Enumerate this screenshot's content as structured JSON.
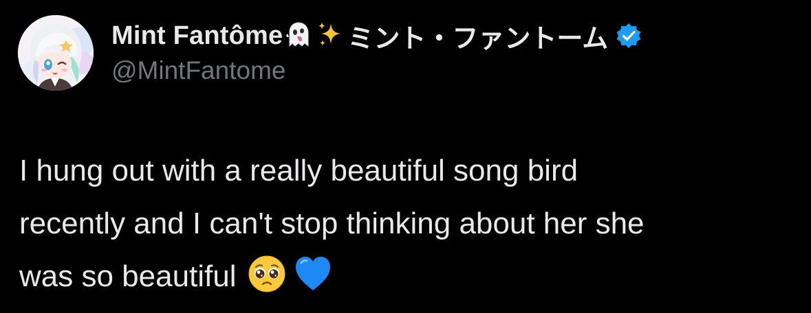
{
  "author": {
    "display_name": "Mint Fantôme",
    "display_name_emojis": [
      "ghost-emoji",
      "sparkles-emoji"
    ],
    "display_name_jp": "ミント・ファントーム",
    "handle": "@MintFantome",
    "verified": true,
    "verified_color": "#1d9bf0"
  },
  "tweet": {
    "lines": [
      "I hung out with a really beautiful song bird",
      "recently and I can't stop thinking about her she",
      "was so beautiful"
    ],
    "trailing_emojis": [
      "pleading-face-emoji",
      "blue-heart-emoji"
    ]
  },
  "colors": {
    "background": "#000000",
    "text_primary": "#e7e9ea",
    "text_secondary": "#71767b"
  }
}
